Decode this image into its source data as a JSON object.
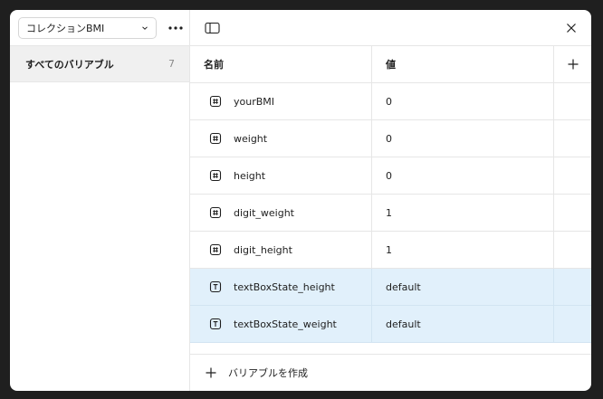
{
  "sidebar": {
    "collection_select": {
      "value": "コレクションBMI",
      "icon": "chevron-down-icon"
    },
    "more_icon": "more-horizontal-icon",
    "groups": [
      {
        "label": "すべてのバリアブル",
        "count": "7"
      }
    ]
  },
  "header": {
    "toggle_sidebar_icon": "sidebar-toggle-icon",
    "close_icon": "close-icon"
  },
  "table": {
    "columns": {
      "name": "名前",
      "value": "値",
      "add_icon": "plus-icon"
    },
    "rows": [
      {
        "type": "number",
        "icon": "hash-icon",
        "name": "yourBMI",
        "value": "0",
        "selected": false
      },
      {
        "type": "number",
        "icon": "hash-icon",
        "name": "weight",
        "value": "0",
        "selected": false
      },
      {
        "type": "number",
        "icon": "hash-icon",
        "name": "height",
        "value": "0",
        "selected": false
      },
      {
        "type": "number",
        "icon": "hash-icon",
        "name": "digit_weight",
        "value": "1",
        "selected": false
      },
      {
        "type": "number",
        "icon": "hash-icon",
        "name": "digit_height",
        "value": "1",
        "selected": false
      },
      {
        "type": "string",
        "icon": "text-type-icon",
        "name": "textBoxState_height",
        "value": "default",
        "selected": true
      },
      {
        "type": "string",
        "icon": "text-type-icon",
        "name": "textBoxState_weight",
        "value": "default",
        "selected": true
      }
    ]
  },
  "footer": {
    "create_label": "バリアブルを作成",
    "icon": "plus-icon"
  },
  "colors": {
    "selected_row": "#e1f0fb",
    "sidebar_active": "#f0f0f0",
    "border": "#e6e6e6"
  }
}
